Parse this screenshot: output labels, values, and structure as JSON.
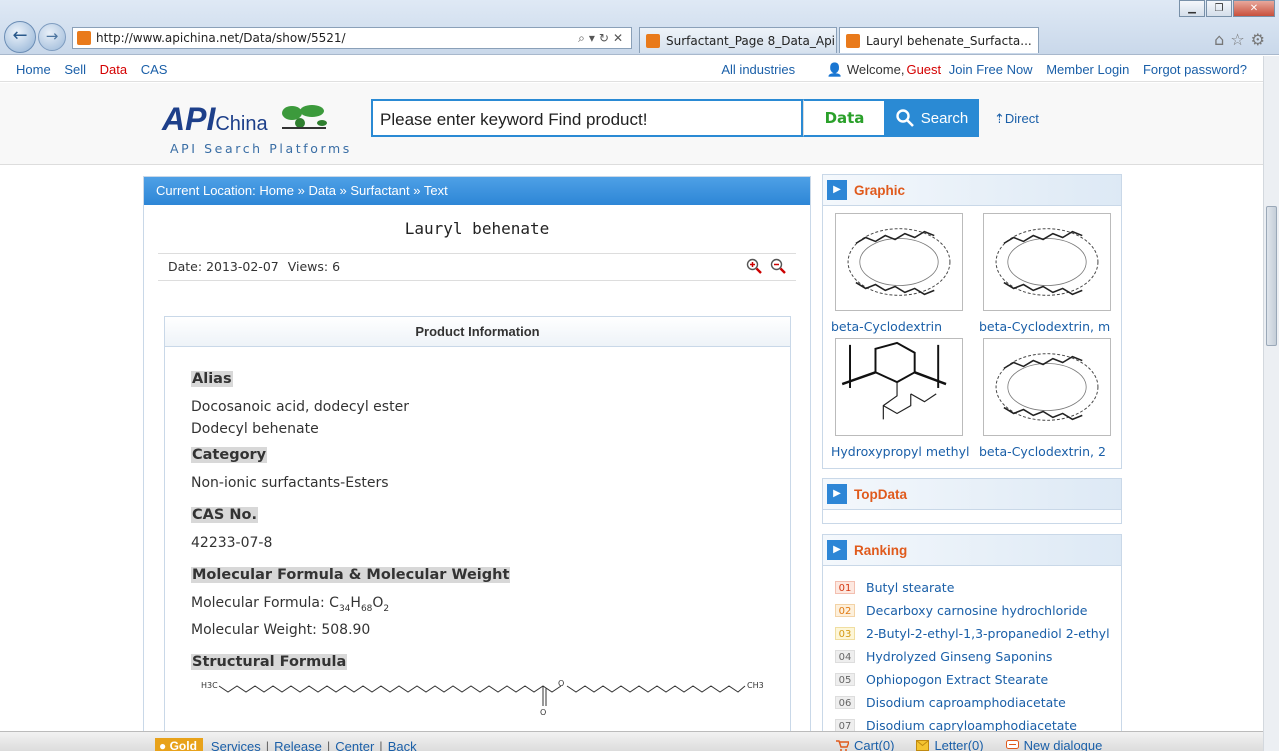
{
  "browser": {
    "url": "http://www.apichina.net/Data/show/5521/",
    "tabs": [
      {
        "label": "Surfactant_Page 8_Data_Api..."
      },
      {
        "label": "Lauryl behenate_Surfacta..."
      }
    ]
  },
  "topnav": {
    "links": [
      "Home",
      "Sell",
      "Data",
      "CAS"
    ],
    "all_industries": "All industries",
    "welcome": "Welcome,",
    "guest": "Guest",
    "join": "Join Free Now",
    "login": "Member Login",
    "forgot": "Forgot password?"
  },
  "header": {
    "logo_api": "API",
    "logo_china": "China",
    "tagline": "API Search Platforms",
    "search_placeholder": "Please enter keyword Find product!",
    "search_type": "Data",
    "search_button": "Search",
    "direct": "Direct"
  },
  "article": {
    "breadcrumb": "Current Location: Home » Data » Surfactant » Text",
    "title": "Lauryl behenate",
    "date_label": "Date:",
    "date": "2013-02-07",
    "views_label": "Views:",
    "views": "6",
    "product_info_title": "Product Information",
    "sections": {
      "alias_title": "Alias",
      "alias_1": "Docosanoic acid, dodecyl ester",
      "alias_2": "Dodecyl behenate",
      "category_title": "Category",
      "category": "Non-ionic surfactants-Esters",
      "cas_title": "CAS No.",
      "cas": "42233-07-8",
      "mf_title": "Molecular Formula & Molecular Weight",
      "mf_label": "Molecular Formula:",
      "mw_label": "Molecular Weight:",
      "mw": "508.90",
      "structural_title": "Structural Formula",
      "struct_left": "H3C",
      "struct_right": "CH3",
      "struct_o": "O"
    }
  },
  "sidebar": {
    "graphic_title": "Graphic",
    "graphics": [
      {
        "caption": "beta-Cyclodextrin"
      },
      {
        "caption": "beta-Cyclodextrin, m"
      },
      {
        "caption": "Hydroxypropyl methyl"
      },
      {
        "caption": "beta-Cyclodextrin, 2"
      }
    ],
    "topdata_title": "TopData",
    "ranking_title": "Ranking",
    "ranking": [
      {
        "num": "01",
        "name": "Butyl stearate"
      },
      {
        "num": "02",
        "name": "Decarboxy carnosine hydrochloride"
      },
      {
        "num": "03",
        "name": "2-Butyl-2-ethyl-1,3-propanediol 2-ethyl"
      },
      {
        "num": "04",
        "name": "Hydrolyzed Ginseng Saponins"
      },
      {
        "num": "05",
        "name": "Ophiopogon Extract Stearate"
      },
      {
        "num": "06",
        "name": "Disodium caproamphodiacetate"
      },
      {
        "num": "07",
        "name": "Disodium capryloamphodiacetate"
      }
    ]
  },
  "bottombar": {
    "gold": "Gold",
    "links": [
      "Services",
      "Release",
      "Center",
      "Back"
    ],
    "cart": "Cart(0)",
    "letter": "Letter(0)",
    "dialogue": "New dialogue"
  }
}
